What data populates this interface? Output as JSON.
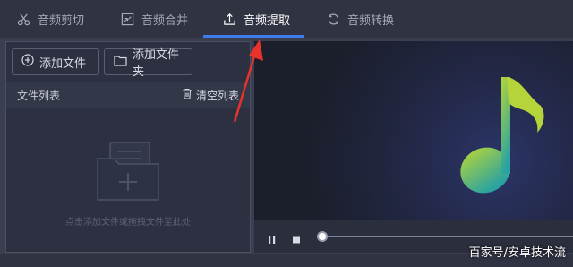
{
  "tabs": [
    {
      "label": "音频剪切",
      "icon": "scissors-icon"
    },
    {
      "label": "音频合并",
      "icon": "merge-icon"
    },
    {
      "label": "音频提取",
      "icon": "extract-icon",
      "active": true
    },
    {
      "label": "音频转换",
      "icon": "convert-icon"
    }
  ],
  "toolbar": {
    "add_file_label": "添加文件",
    "add_folder_label": "添加文件夹"
  },
  "file_list": {
    "title": "文件列表",
    "clear_label": "清空列表",
    "empty_hint": "点击添加文件或拖拽文件至此处"
  },
  "player": {
    "progress": 0.0
  },
  "watermark": "百家号/安卓技术流",
  "colors": {
    "accent": "#3f7bea",
    "arrow": "#e8322c",
    "note_gradient": [
      "#b5d43a",
      "#2aa3a0"
    ]
  }
}
